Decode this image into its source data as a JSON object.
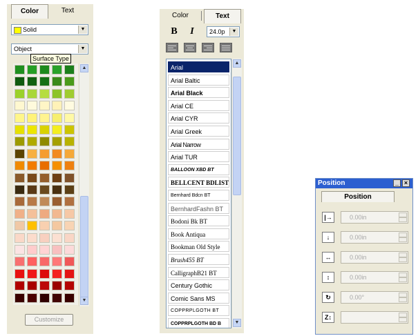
{
  "color_panel": {
    "tabs": [
      "Color",
      "Text"
    ],
    "active_tab": "Color",
    "fill_style": "Solid",
    "fill_color": "#ffff00",
    "object_select": "Object",
    "tooltip": "Surface Type",
    "customize_label": "Customize",
    "swatch_rows": [
      [
        "#1f8f1f",
        "#259e25",
        "#1d8a1d",
        "#2aa22a",
        "#1b7f1b"
      ],
      [
        "#0f5a0f",
        "#106010",
        "#157015",
        "#3a8a1a",
        "#4a9a1a"
      ],
      [
        "#9bd12a",
        "#a9d738",
        "#b6dd40",
        "#8cc428",
        "#a0cc30"
      ],
      [
        "#fff8d0",
        "#fffadc",
        "#fff6c6",
        "#fff2b8",
        "#fffbe0"
      ],
      [
        "#fff68a",
        "#fff37a",
        "#fff490",
        "#f7ef70",
        "#fff9a6"
      ],
      [
        "#e6e000",
        "#ede600",
        "#d9d200",
        "#f4ee20",
        "#ccc400"
      ],
      [
        "#9c9a00",
        "#b0aa00",
        "#8f8a00",
        "#a6a000",
        "#b8b200"
      ],
      [
        "#5c4400",
        "#f7b040",
        "#f59c30",
        "#f28a20",
        "#f5a838"
      ],
      [
        "#f08a00",
        "#f27c00",
        "#e86e00",
        "#f59000",
        "#ee8010"
      ],
      [
        "#8a5a2a",
        "#7a4a1a",
        "#955f2c",
        "#6f3f12",
        "#80522a"
      ],
      [
        "#3a2a10",
        "#5a3a16",
        "#6a4a1e",
        "#4a3010",
        "#5c4016"
      ],
      [
        "#a86a3a",
        "#b87a48",
        "#c08a58",
        "#9a5e30",
        "#b07040"
      ],
      [
        "#f0b088",
        "#f4c09a",
        "#eeaa80",
        "#f2b890",
        "#f6c8a6"
      ],
      [
        "#f0c8a6",
        "#ffc000",
        "#f8d0b0",
        "#f4c8a0",
        "#f8d4b4"
      ],
      [
        "#fad8c8",
        "#fcdccc",
        "#f8d0c0",
        "#fbe0d2",
        "#f9d6c6"
      ],
      [
        "#fbe4e4",
        "#ffcccc",
        "#ffd4d4",
        "#f8c0c0",
        "#fcdada"
      ],
      [
        "#f87070",
        "#ff6060",
        "#f86868",
        "#ff7878",
        "#f05858"
      ],
      [
        "#e81010",
        "#f01818",
        "#dd0c0c",
        "#f42020",
        "#e41414"
      ],
      [
        "#b00000",
        "#a80000",
        "#bc0808",
        "#9c0000",
        "#b40404"
      ],
      [
        "#3a0000",
        "#4a0000",
        "#300000",
        "#420404",
        "#380000"
      ]
    ]
  },
  "text_panel": {
    "tabs": [
      "Color",
      "Text"
    ],
    "active_tab": "Text",
    "bold_label": "B",
    "italic_label": "I",
    "font_size": "24.0p",
    "fonts": [
      "Arial",
      "Arial Baltic",
      "Arial Black",
      "Arial CE",
      "Arial CYR",
      "Arial Greek",
      "Arial Narrow",
      "Arial TUR",
      "BALLOON XBD BT",
      "BELLCENT BDLIST B",
      "Bernhard Bdcn BT",
      "BernhardFashn BT",
      "Bodoni Bk BT",
      "Book Antiqua",
      "Bookman Old Style",
      "Brush455 BT",
      "CalligraphB21 BT",
      "Century Gothic",
      "Comic Sans MS",
      "COPPRPLGOTH BT",
      "COPPRPLGOTH BD B"
    ],
    "selected_font": "Arial"
  },
  "position_panel": {
    "title": "Position",
    "tab": "Position",
    "rows": [
      {
        "icon": "move-horizontal-icon",
        "glyph": "|→",
        "value": "0.00in"
      },
      {
        "icon": "move-vertical-icon",
        "glyph": "↓",
        "value": "0.00in"
      },
      {
        "icon": "width-icon",
        "glyph": "↔",
        "value": "0.00in"
      },
      {
        "icon": "height-icon",
        "glyph": "↕",
        "value": "0.00in"
      },
      {
        "icon": "rotate-icon",
        "glyph": "↻",
        "value": "0.00°"
      },
      {
        "icon": "z-order-icon",
        "glyph": "Z↕",
        "value": ""
      }
    ]
  }
}
